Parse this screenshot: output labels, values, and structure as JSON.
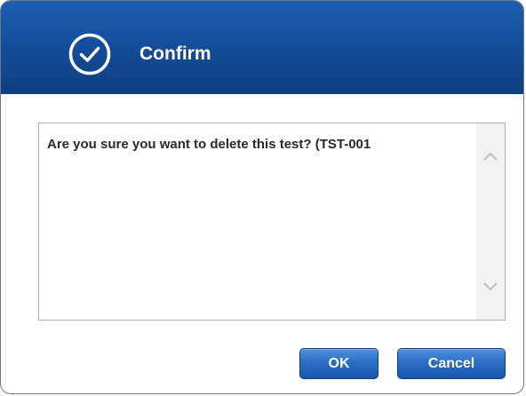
{
  "dialog": {
    "title": "Confirm",
    "title_icon": "check-circle-icon",
    "message": "Are you sure you want to delete this test? (TST-001",
    "buttons": {
      "ok_label": "OK",
      "cancel_label": "Cancel"
    }
  },
  "colors": {
    "titlebar": "#154e9c",
    "button": "#2a6cc4",
    "border": "#6e7a88"
  }
}
